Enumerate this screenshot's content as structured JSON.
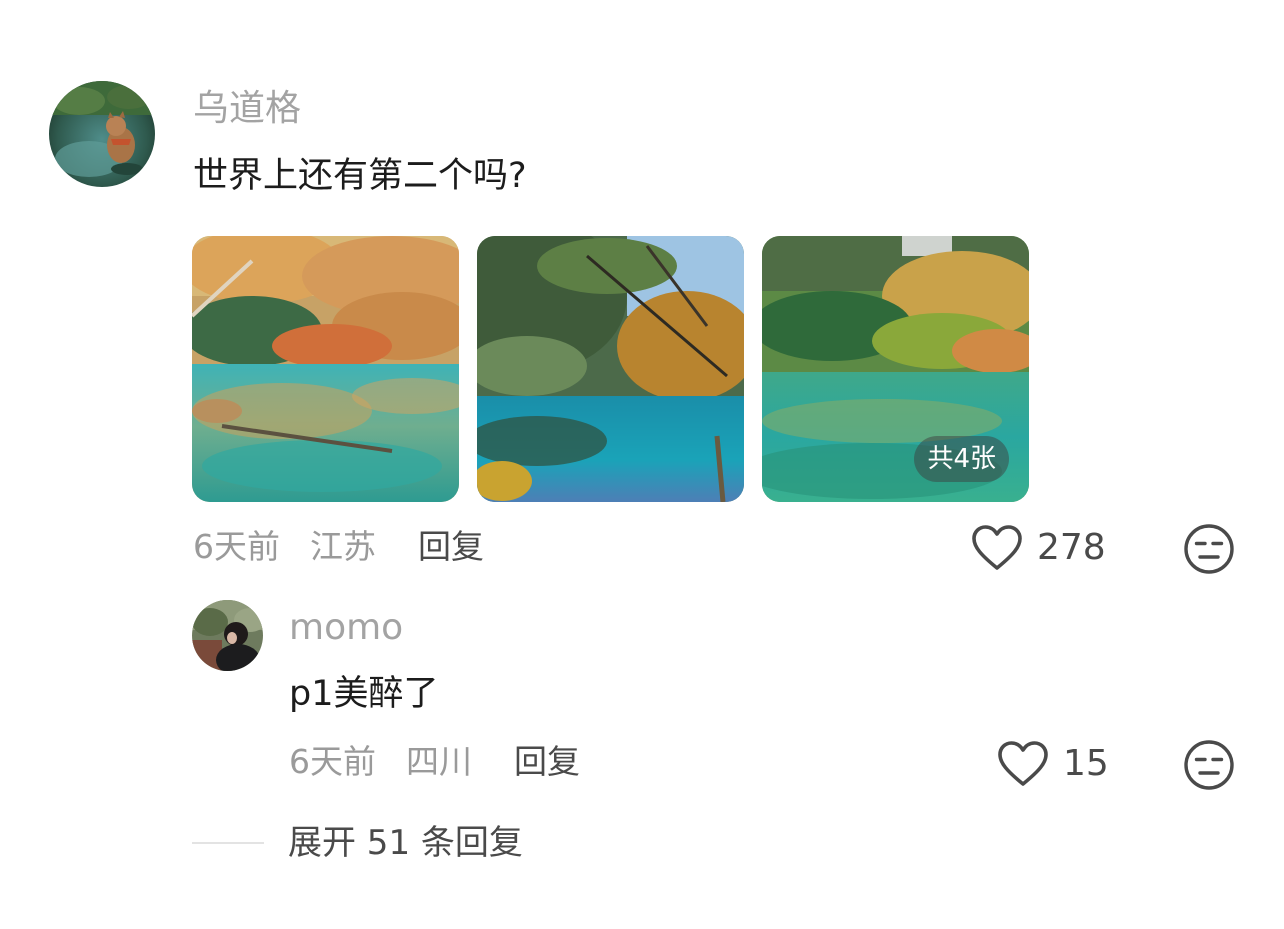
{
  "comment": {
    "author": "乌道格",
    "text": "世界上还有第二个吗?",
    "image_count_badge": "共4张",
    "time": "6天前",
    "location": "江苏",
    "reply_label": "回复",
    "likes": "278"
  },
  "reply": {
    "author": "momo",
    "text": "p1美醉了",
    "time": "6天前",
    "location": "四川",
    "reply_label": "回复",
    "likes": "15"
  },
  "expand_replies": "展开 51 条回复",
  "icons": {
    "like": "heart-outline-icon",
    "reaction": "neutral-face-icon"
  },
  "colors": {
    "secondary_text": "#9a9a9a",
    "action_text": "#4a4a4a",
    "icon": "#4a4a4a"
  }
}
